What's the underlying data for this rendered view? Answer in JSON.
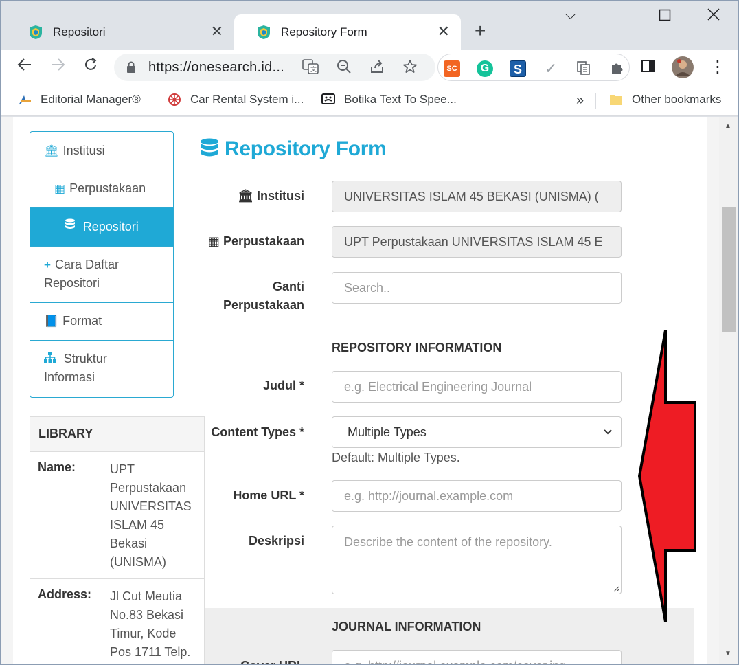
{
  "browser": {
    "tabs": [
      {
        "label": "Repositori",
        "active": false
      },
      {
        "label": "Repository Form",
        "active": true
      }
    ],
    "new_tab_label": "+",
    "url": "https://onesearch.id...",
    "extensions": [
      "SC",
      "G"
    ],
    "bookmarks": [
      {
        "label": "Editorial Manager®"
      },
      {
        "label": "Car Rental System i..."
      },
      {
        "label": "Botika Text To Spee..."
      }
    ],
    "bookmarks_overflow": "»",
    "other_bookmarks": "Other bookmarks"
  },
  "sidebar": {
    "items": [
      {
        "label": "Institusi",
        "icon": "bank-icon"
      },
      {
        "label": "Perpustakaan",
        "icon": "building-icon"
      },
      {
        "label": "Repositori",
        "icon": "database-icon",
        "active": true
      },
      {
        "label_line1": "Cara Daftar",
        "label_line2": "Repositori",
        "icon": "plus-icon"
      },
      {
        "label": "Format",
        "icon": "book-icon"
      },
      {
        "label_line1": "Struktur",
        "label_line2": "Informasi",
        "icon": "sitemap-icon"
      }
    ]
  },
  "library": {
    "heading": "LIBRARY",
    "name_label": "Name:",
    "name_lines": [
      "UPT",
      "Perpustakaan",
      "UNIVERSITAS",
      "ISLAM 45",
      "Bekasi",
      "(UNISMA)"
    ],
    "address_label": "Address:",
    "address_lines": [
      "Jl Cut Meutia",
      "No.83 Bekasi",
      "Timur, Kode",
      "Pos 1711 Telp."
    ]
  },
  "form": {
    "title": "Repository Form",
    "institusi_label": "Institusi",
    "institusi_value": "UNIVERSITAS ISLAM 45 BEKASI (UNISMA) (",
    "perpustakaan_label": "Perpustakaan",
    "perpustakaan_value": "UPT Perpustakaan UNIVERSITAS ISLAM 45 E",
    "ganti_label_line1": "Ganti",
    "ganti_label_line2": "Perpustakaan",
    "ganti_placeholder": "Search..",
    "repo_section": "REPOSITORY INFORMATION",
    "judul_label": "Judul *",
    "judul_placeholder": "e.g. Electrical Engineering Journal",
    "content_types_label": "Content Types *",
    "content_types_value": "Multiple Types",
    "content_types_help": "Default: Multiple Types.",
    "home_url_label": "Home URL *",
    "home_url_placeholder": "e.g. http://journal.example.com",
    "deskripsi_label": "Deskripsi",
    "deskripsi_placeholder": "Describe the content of the repository.",
    "journal_section": "JOURNAL INFORMATION",
    "cover_url_label": "Cover URL",
    "cover_url_placeholder": "e.g. http://journal.example.com/cover.jpg"
  },
  "colors": {
    "accent": "#1fa9d6",
    "arrow": "#ee1c24"
  }
}
